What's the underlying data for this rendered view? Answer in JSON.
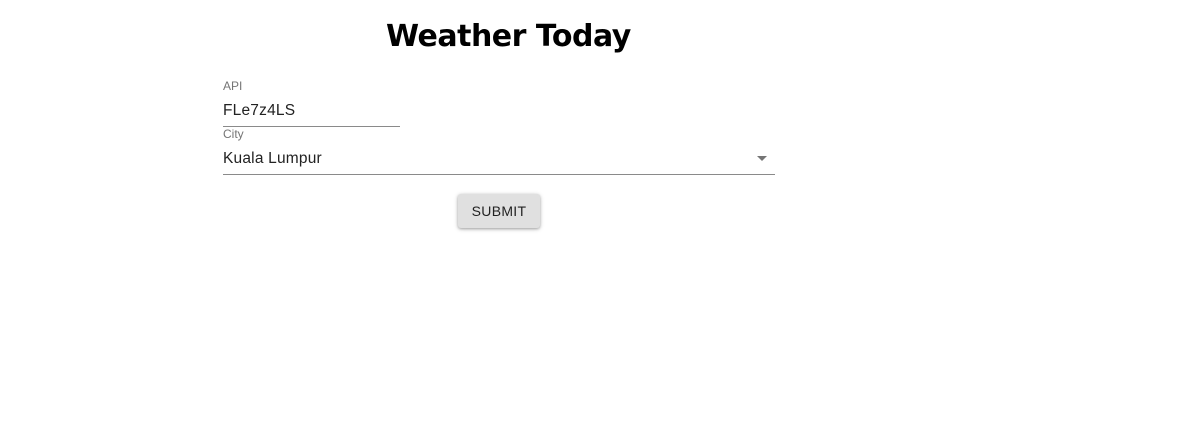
{
  "page": {
    "title": "Weather Today"
  },
  "form": {
    "api": {
      "label": "API",
      "value": "FLe7z4LS"
    },
    "city": {
      "label": "City",
      "selected": "Kuala Lumpur",
      "icon": "chevron-down-icon"
    },
    "submit_label": "SUBMIT"
  }
}
